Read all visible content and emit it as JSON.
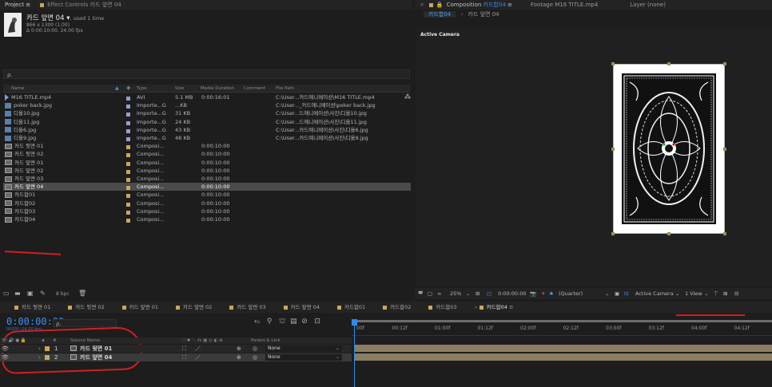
{
  "project_panel": {
    "tab_label": "Project",
    "menu_glyph": "≡",
    "effect_controls_label": "Effect Controls 카드 앞면 04",
    "item_name": "카드 앞면 04 ▾",
    "used_count": ", used 1 time",
    "dimensions": "866 x 1300 (1.00)",
    "duration": "Δ 0:00:10:00, 24.00 fps",
    "search_placeholder": "ρ.",
    "columns": {
      "name": "Name",
      "type": "Type",
      "size": "Size",
      "media_duration": "Media Duration",
      "comment": "Comment",
      "file_path": "File Path"
    },
    "bpc": "8 bpc",
    "items": [
      {
        "name": "M16 TITLE.mp4",
        "icon": "video-icon",
        "color": "#8a9fd4",
        "type": "AVI",
        "size": "5.1 MB",
        "duration": "0:00:16:01",
        "path": "C:\\User...카드애니메이션\\M16 TITLE.mp4"
      },
      {
        "name": "poker back.jpg",
        "icon": "image-file-icon",
        "color": "#9a9ad8",
        "type": "Importe...G",
        "size": "...KB",
        "duration": "",
        "path": "C:\\User..._카드애니메이션\\poker back.jpg"
      },
      {
        "name": "디올10.jpg",
        "icon": "image-file-icon",
        "color": "#9a9ad8",
        "type": "Importe...G",
        "size": "31 KB",
        "duration": "",
        "path": "C:\\User...드애니메이션\\사진\\디올10.jpg"
      },
      {
        "name": "디올11.jpg",
        "icon": "image-file-icon",
        "color": "#9a9ad8",
        "type": "Importe...G",
        "size": "24 KB",
        "duration": "",
        "path": "C:\\User...드애니메이션\\사진\\디올11.jpg"
      },
      {
        "name": "디올6.jpg",
        "icon": "image-file-icon",
        "color": "#9a9ad8",
        "type": "Importe...G",
        "size": "43 KB",
        "duration": "",
        "path": "C:\\User...카드애니메이션\\사진\\디올6.jpg"
      },
      {
        "name": "디올9.jpg",
        "icon": "image-file-icon",
        "color": "#9a9ad8",
        "type": "Importe...G",
        "size": "48 KB",
        "duration": "",
        "path": "C:\\User...카드애니메이션\\사진\\디올9.jpg"
      },
      {
        "name": "카드 뒷면 01",
        "icon": "composition-icon",
        "color": "#c8a85a",
        "type": "Composi...",
        "size": "",
        "duration": "0:00:10:00",
        "path": ""
      },
      {
        "name": "카드 뒷면 02",
        "icon": "composition-icon",
        "color": "#c8a85a",
        "type": "Composi...",
        "size": "",
        "duration": "0:00:10:00",
        "path": ""
      },
      {
        "name": "카드 앞면 01",
        "icon": "composition-icon",
        "color": "#c8a85a",
        "type": "Composi...",
        "size": "",
        "duration": "0:00:10:00",
        "path": ""
      },
      {
        "name": "카드 앞면 02",
        "icon": "composition-icon",
        "color": "#c8a85a",
        "type": "Composi...",
        "size": "",
        "duration": "0:00:10:00",
        "path": ""
      },
      {
        "name": "카드 앞면 03",
        "icon": "composition-icon",
        "color": "#c8a85a",
        "type": "Composi...",
        "size": "",
        "duration": "0:00:10:00",
        "path": ""
      },
      {
        "name": "카드 앞면 04",
        "icon": "composition-icon",
        "color": "#c8a85a",
        "type": "Composi...",
        "size": "",
        "duration": "0:00:10:00",
        "path": "",
        "selected": true
      },
      {
        "name": "카드합01",
        "icon": "composition-icon",
        "color": "#c8a85a",
        "type": "Composi...",
        "size": "",
        "duration": "0:00:10:00",
        "path": ""
      },
      {
        "name": "카드합02",
        "icon": "composition-icon",
        "color": "#c8a85a",
        "type": "Composi...",
        "size": "",
        "duration": "0:00:10:00",
        "path": ""
      },
      {
        "name": "카드합03",
        "icon": "composition-icon",
        "color": "#c8a85a",
        "type": "Composi...",
        "size": "",
        "duration": "0:00:10:00",
        "path": ""
      },
      {
        "name": "카드합04",
        "icon": "composition-icon",
        "color": "#c8a85a",
        "type": "Composi...",
        "size": "",
        "duration": "0:00:10:00",
        "path": ""
      }
    ]
  },
  "comp_panel": {
    "composition_label": "Composition",
    "comp_name": "카드합04",
    "footage_label": "Footage M16 TITLE.mp4",
    "layer_label": "Layer (none)",
    "sub_tab_active": "카드합04",
    "sub_tab_other": "카드 앞면 04",
    "active_camera_overlay": "Active Camera",
    "toolbar": {
      "zoom": "25%",
      "timecode": "0:00:00:00",
      "resolution": "(Quarter)",
      "camera": "Active Camera",
      "views": "1 View"
    }
  },
  "timeline": {
    "tabs": [
      "카드 뒷면 01",
      "카드 뒷면 02",
      "카드 앞면 01",
      "카드 앞면 02",
      "카드 앞면 03",
      "카드 앞면 04",
      "카드합01",
      "카드합02",
      "카드합03",
      "카드합04"
    ],
    "active_tab_menu": "≡",
    "timecode": "0:00:00:00",
    "fps_line": "00000 (24.00 fps)",
    "search_placeholder": "ρ.",
    "col_source_name": "Source Name",
    "col_parent": "Parent & Link",
    "col_hash": "#",
    "ruler": [
      "00f",
      "00:12f",
      "01:00f",
      "01:12f",
      "02:00f",
      "02:12f",
      "03:00f",
      "03:12f",
      "04:00f",
      "04:12f"
    ],
    "layers": [
      {
        "num": "1",
        "name": "카드 뒷면 01",
        "parent": "None"
      },
      {
        "num": "2",
        "name": "카드 앞면 04",
        "parent": "None"
      }
    ]
  }
}
